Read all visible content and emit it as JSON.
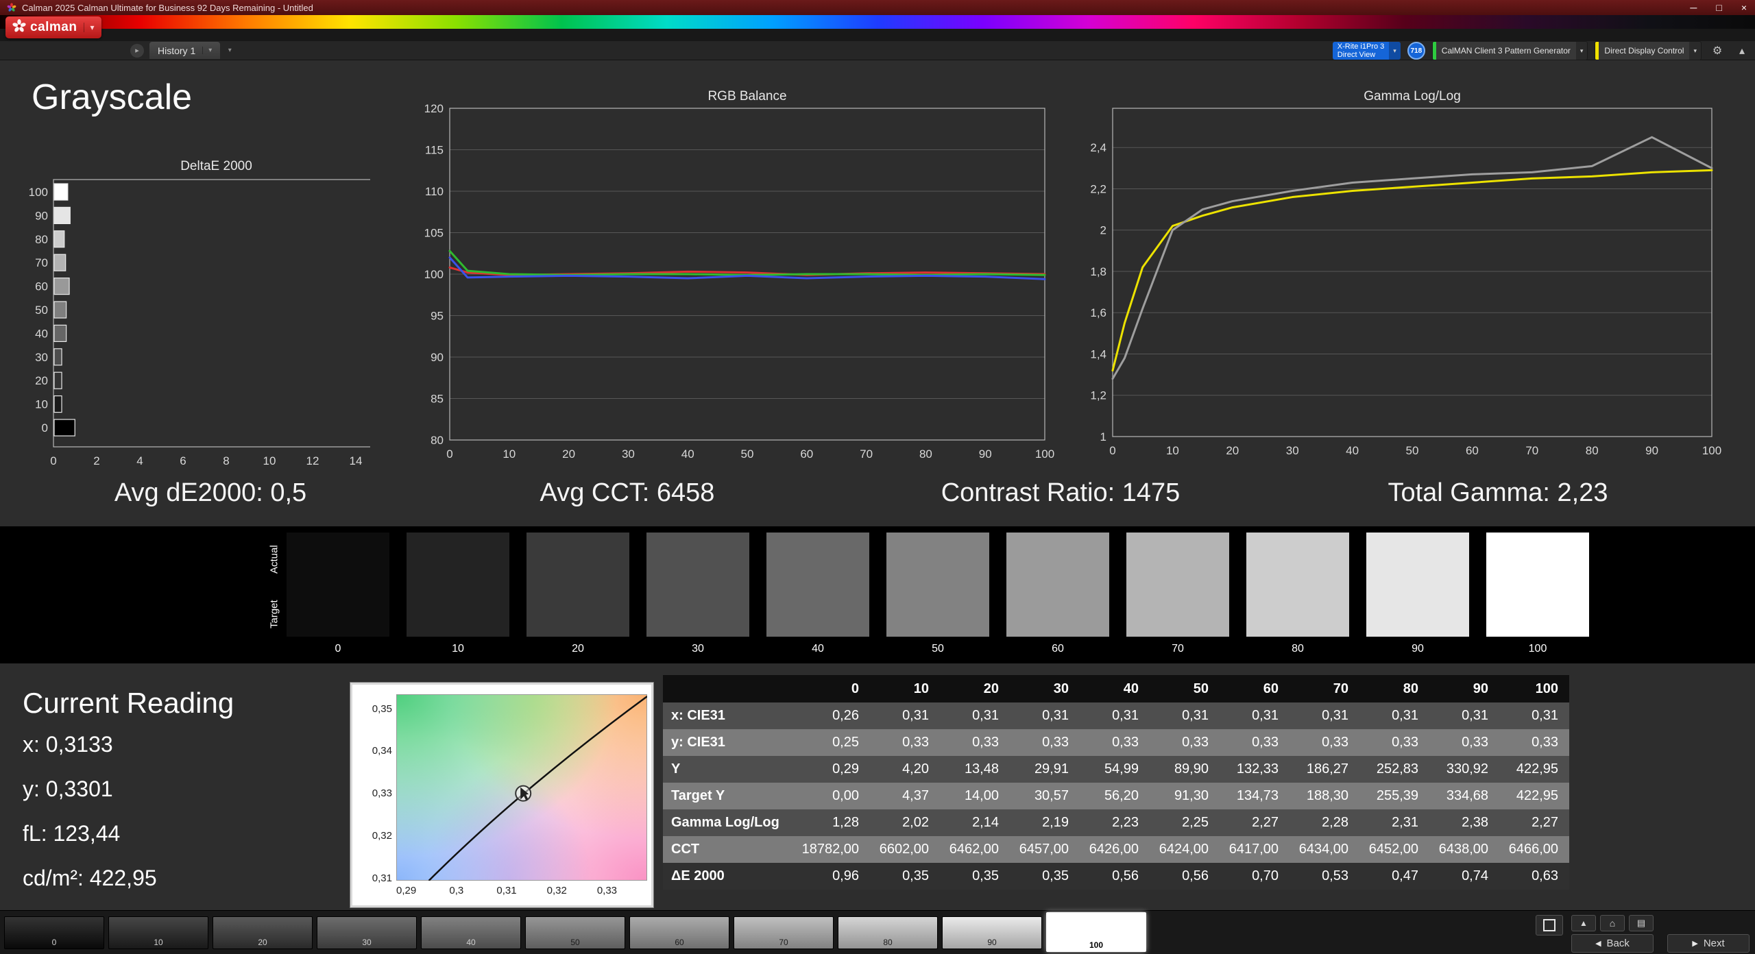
{
  "titlebar": {
    "title": "Calman 2025 Calman Ultimate for Business 92 Days Remaining - Untitled",
    "minimize": "─",
    "maximize": "□",
    "close": "×"
  },
  "logo": {
    "label": "calman",
    "caret": "▾"
  },
  "tabs": {
    "nav_icon": "▸",
    "history_label": "History 1",
    "caret": "▾",
    "menu_caret": "▾"
  },
  "devices": {
    "meter": {
      "line1": "X-Rite i1Pro 3",
      "line2": "Direct View",
      "caret": "▾"
    },
    "badge": "718",
    "generator": {
      "label": "CalMAN Client 3 Pattern Generator",
      "caret": "▾",
      "accent": "#2ecc40"
    },
    "display": {
      "label": "Direct Display Control",
      "caret": "▾",
      "accent": "#f0e000"
    },
    "settings_icon": "⚙",
    "collapse_icon": "▴"
  },
  "page": {
    "title": "Grayscale"
  },
  "stats": [
    "Avg dE2000: 0,5",
    "Avg CCT: 6458",
    "Contrast Ratio: 1475",
    "Total Gamma: 2,23"
  ],
  "swatches": {
    "actual_label": "Actual",
    "target_label": "Target",
    "levels": [
      {
        "label": "0",
        "color": "#0d0d0d"
      },
      {
        "label": "10",
        "color": "#232323"
      },
      {
        "label": "20",
        "color": "#3a3a3a"
      },
      {
        "label": "30",
        "color": "#515151"
      },
      {
        "label": "40",
        "color": "#696969"
      },
      {
        "label": "50",
        "color": "#828282"
      },
      {
        "label": "60",
        "color": "#9b9b9b"
      },
      {
        "label": "70",
        "color": "#b4b4b4"
      },
      {
        "label": "80",
        "color": "#cdcdcd"
      },
      {
        "label": "90",
        "color": "#e6e6e6"
      },
      {
        "label": "100",
        "color": "#ffffff"
      }
    ]
  },
  "current_reading": {
    "title": "Current Reading",
    "values": [
      "x: 0,3133",
      "y: 0,3301",
      "fL: 123,44",
      "cd/m²: 422,95"
    ]
  },
  "table": {
    "columns": [
      "0",
      "10",
      "20",
      "30",
      "40",
      "50",
      "60",
      "70",
      "80",
      "90",
      "100"
    ],
    "rows": [
      {
        "label": "x: CIE31",
        "values": [
          "0,26",
          "0,31",
          "0,31",
          "0,31",
          "0,31",
          "0,31",
          "0,31",
          "0,31",
          "0,31",
          "0,31",
          "0,31"
        ]
      },
      {
        "label": "y: CIE31",
        "values": [
          "0,25",
          "0,33",
          "0,33",
          "0,33",
          "0,33",
          "0,33",
          "0,33",
          "0,33",
          "0,33",
          "0,33",
          "0,33"
        ]
      },
      {
        "label": "Y",
        "values": [
          "0,29",
          "4,20",
          "13,48",
          "29,91",
          "54,99",
          "89,90",
          "132,33",
          "186,27",
          "252,83",
          "330,92",
          "422,95"
        ]
      },
      {
        "label": "Target Y",
        "values": [
          "0,00",
          "4,37",
          "14,00",
          "30,57",
          "56,20",
          "91,30",
          "134,73",
          "188,30",
          "255,39",
          "334,68",
          "422,95"
        ]
      },
      {
        "label": "Gamma Log/Log",
        "values": [
          "1,28",
          "2,02",
          "2,14",
          "2,19",
          "2,23",
          "2,25",
          "2,27",
          "2,28",
          "2,31",
          "2,38",
          "2,27"
        ]
      },
      {
        "label": "CCT",
        "values": [
          "18782,00",
          "6602,00",
          "6462,00",
          "6457,00",
          "6426,00",
          "6424,00",
          "6417,00",
          "6434,00",
          "6452,00",
          "6438,00",
          "6466,00"
        ]
      },
      {
        "label": "ΔE 2000",
        "values": [
          "0,96",
          "0,35",
          "0,35",
          "0,35",
          "0,56",
          "0,56",
          "0,70",
          "0,53",
          "0,47",
          "0,74",
          "0,63"
        ]
      }
    ]
  },
  "bottom": {
    "selected": "100",
    "back_label": "Back",
    "next_label": "Next"
  },
  "chart_data": [
    {
      "type": "bar",
      "title": "DeltaE 2000",
      "orientation": "horizontal",
      "xlabel": "",
      "ylabel": "",
      "categories": [
        0,
        10,
        20,
        30,
        40,
        50,
        60,
        70,
        80,
        90,
        100
      ],
      "values": [
        0.96,
        0.35,
        0.35,
        0.35,
        0.56,
        0.56,
        0.7,
        0.53,
        0.47,
        0.74,
        0.63
      ],
      "xlim": [
        0,
        14
      ],
      "xticks": [
        0,
        2,
        4,
        6,
        8,
        10,
        12,
        14
      ],
      "ylim": [
        0,
        100
      ]
    },
    {
      "type": "line",
      "title": "RGB Balance",
      "xlabel": "",
      "ylabel": "",
      "x": [
        0,
        3,
        10,
        20,
        30,
        40,
        50,
        60,
        70,
        80,
        90,
        100
      ],
      "series": [
        {
          "name": "Red",
          "color": "#e03232",
          "values": [
            100.8,
            100.2,
            99.9,
            100.0,
            100.1,
            100.3,
            100.2,
            99.9,
            100.1,
            100.2,
            100.1,
            100.0
          ]
        },
        {
          "name": "Green",
          "color": "#2fba2f",
          "values": [
            102.8,
            100.4,
            100.0,
            99.9,
            100.0,
            100.0,
            99.9,
            100.0,
            100.0,
            99.9,
            100.0,
            99.9
          ]
        },
        {
          "name": "Blue",
          "color": "#3a52e8",
          "values": [
            102.0,
            99.6,
            99.7,
            99.8,
            99.7,
            99.5,
            99.8,
            99.5,
            99.7,
            99.8,
            99.7,
            99.4
          ]
        }
      ],
      "ylim": [
        80,
        120
      ],
      "yticks": [
        [
          80,
          "80"
        ],
        [
          85,
          "85"
        ],
        [
          90,
          "90"
        ],
        [
          95,
          "95"
        ],
        [
          100,
          "100"
        ],
        [
          105,
          "105"
        ],
        [
          110,
          "110"
        ],
        [
          115,
          "115"
        ],
        [
          120,
          "120"
        ]
      ],
      "xticks": [
        0,
        10,
        20,
        30,
        40,
        50,
        60,
        70,
        80,
        90,
        100
      ]
    },
    {
      "type": "line",
      "title": "Gamma Log/Log",
      "xlabel": "",
      "ylabel": "",
      "x": [
        0,
        2,
        5,
        10,
        15,
        20,
        30,
        40,
        50,
        60,
        70,
        80,
        90,
        100
      ],
      "series": [
        {
          "name": "Target Gamma",
          "color": "#ece200",
          "values": [
            1.32,
            1.55,
            1.82,
            2.02,
            2.07,
            2.11,
            2.16,
            2.19,
            2.21,
            2.23,
            2.25,
            2.26,
            2.28,
            2.29
          ]
        },
        {
          "name": "Measured Gamma",
          "color": "#9e9e9e",
          "values": [
            1.28,
            1.38,
            1.62,
            2.0,
            2.1,
            2.14,
            2.19,
            2.23,
            2.25,
            2.27,
            2.28,
            2.31,
            2.45,
            2.3
          ]
        }
      ],
      "ylim": [
        1,
        2.59
      ],
      "yticks": [
        [
          1,
          "1"
        ],
        [
          1.2,
          "1,2"
        ],
        [
          1.4,
          "1,4"
        ],
        [
          1.6,
          "1,6"
        ],
        [
          1.8,
          "1,8"
        ],
        [
          2,
          "2"
        ],
        [
          2.2,
          "2,2"
        ],
        [
          2.4,
          "2,4"
        ]
      ],
      "xticks": [
        0,
        10,
        20,
        30,
        40,
        50,
        60,
        70,
        80,
        90,
        100
      ]
    },
    {
      "type": "scatter",
      "title": "CIE xy Chromaticity",
      "xlabel": "x",
      "ylabel": "y",
      "xlim": [
        0.288,
        0.338
      ],
      "ylim": [
        0.3095,
        0.3535
      ],
      "xticks": [
        [
          0.29,
          "0,29"
        ],
        [
          0.3,
          "0,3"
        ],
        [
          0.31,
          "0,31"
        ],
        [
          0.32,
          "0,32"
        ],
        [
          0.33,
          "0,33"
        ]
      ],
      "yticks": [
        [
          0.35,
          "0,35"
        ],
        [
          0.34,
          "0,34"
        ],
        [
          0.33,
          "0,33"
        ],
        [
          0.32,
          "0,32"
        ],
        [
          0.31,
          "0,31"
        ]
      ],
      "locus": {
        "start": [
          0.2945,
          0.3095
        ],
        "control": [
          0.3126,
          0.3309
        ],
        "end": [
          0.338,
          0.353
        ]
      },
      "points": [
        [
          0.3133,
          0.3301
        ]
      ]
    }
  ]
}
